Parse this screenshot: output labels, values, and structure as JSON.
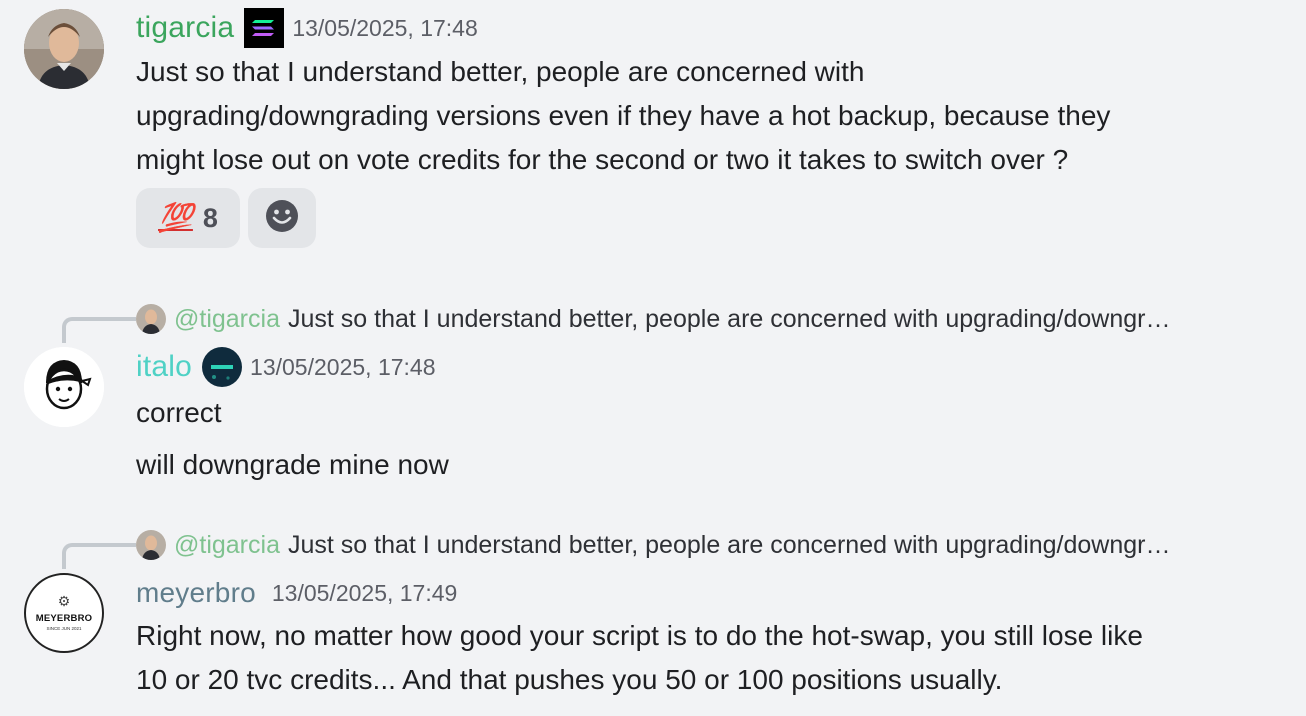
{
  "messages": [
    {
      "username": "tigarcia",
      "username_color": "#43b581",
      "timestamp": "13/05/2025, 17:48",
      "lines": [
        "Just so that I understand better, people are concerned with",
        "upgrading/downgrading versions even if they have a hot backup, because they",
        "might lose out on vote credits for the second or two it takes to switch over ?"
      ],
      "reactions": [
        {
          "emoji": "100-emoji",
          "glyph": "💯",
          "count": "8"
        }
      ]
    },
    {
      "reply": {
        "mention": "@tigarcia",
        "text": "Just so that I understand better, people are concerned with upgrading/downgr…"
      },
      "username": "italo",
      "username_color": "#4fd1c5",
      "timestamp": "13/05/2025, 17:48",
      "lines": [
        "correct",
        "will downgrade mine now"
      ]
    },
    {
      "reply": {
        "mention": "@tigarcia",
        "text": "Just so that I understand better, people are concerned with upgrading/downgr…"
      },
      "username": "meyerbro",
      "username_color": "#607d8b",
      "timestamp": "13/05/2025, 17:49",
      "lines": [
        "Right now, no matter how good your script is to do the hot-swap, you still lose like",
        "10 or 20 tvc credits... And that pushes you 50 or 100 positions usually."
      ],
      "avatar_text": "MEYERBRO",
      "avatar_subtext": "SINCE JUN 2021"
    }
  ]
}
